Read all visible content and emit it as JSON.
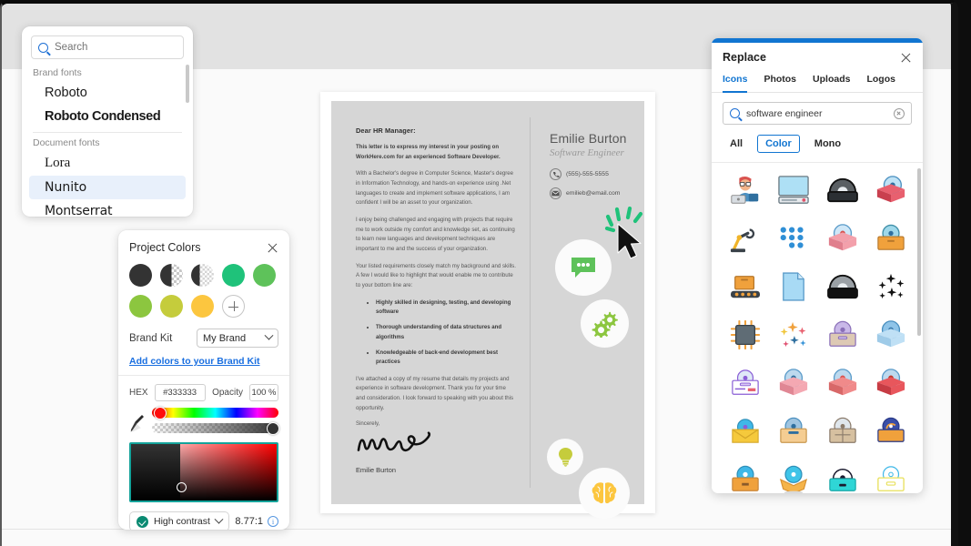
{
  "font_picker": {
    "search": {
      "placeholder": "Search",
      "value": "",
      "icon": "search-icon"
    },
    "groups": [
      {
        "label": "Brand fonts",
        "fonts": [
          {
            "name": "Roboto",
            "selected": false
          },
          {
            "name": "Roboto Condensed",
            "selected": false
          }
        ]
      },
      {
        "label": "Document fonts",
        "fonts": [
          {
            "name": "Lora",
            "selected": false
          },
          {
            "name": "Nunito",
            "selected": true
          },
          {
            "name": "Montserrat",
            "selected": false
          }
        ]
      }
    ]
  },
  "project_colors": {
    "title": "Project Colors",
    "close_icon": "close-icon",
    "swatches": [
      {
        "name": "dark-solid",
        "hex": "#333333",
        "style": "solid"
      },
      {
        "name": "dark-half",
        "hex": "#333333",
        "style": "half-checker"
      },
      {
        "name": "dark-quarter",
        "hex": "#333333",
        "style": "quarter-checker"
      },
      {
        "name": "green-teal",
        "hex": "#1fc27a",
        "style": "solid"
      },
      {
        "name": "green-medium",
        "hex": "#5ec25a",
        "style": "solid"
      },
      {
        "name": "green-light",
        "hex": "#8cc63f",
        "style": "solid"
      },
      {
        "name": "yellow-green",
        "hex": "#c5cc3c",
        "style": "solid"
      },
      {
        "name": "amber",
        "hex": "#fcc63f",
        "style": "solid"
      },
      {
        "name": "add",
        "hex": "",
        "style": "add"
      }
    ],
    "brand_kit_label": "Brand Kit",
    "brand_kit_value": "My Brand",
    "add_colors_link": "Add colors to your Brand Kit",
    "hex_label": "HEX",
    "hex_value": "#333333",
    "opacity_label": "Opacity",
    "opacity_value": "100 %",
    "eyedropper_icon": "eyedropper-icon",
    "contrast_label": "High contrast",
    "contrast_ratio": "8.77:1",
    "info_icon": "info-icon",
    "selected_swatch_border": "#14a39a"
  },
  "document": {
    "greeting": "Dear HR Manager:",
    "paragraphs": [
      {
        "bold": true,
        "text": "This letter is to express my interest in your posting on WorkHere.com for an experienced Software Developer."
      },
      {
        "bold": false,
        "text": "With a Bachelor's degree in Computer Science, Master's degree in Information Technology, and hands-on experience using .Net languages to create and implement software applications, I am confident I will be an asset to your organization."
      },
      {
        "bold": false,
        "text": "I enjoy being challenged and engaging with projects that require me to work outside my comfort and knowledge set, as continuing to learn new languages and development techniques are important to me and the success of your organization."
      },
      {
        "bold": false,
        "text": "Your listed requirements closely match my background and skills. A few I would like to highlight that would enable me to contribute to your bottom line are:"
      }
    ],
    "bullets": [
      "Highly skilled in designing, testing, and developing software",
      "Thorough understanding of data structures and algorithms",
      "Knowledgeable of back-end development best practices"
    ],
    "closing_paragraph": "I've attached a copy of my resume that details my projects and experience in software development. Thank you for your time and consideration. I look forward to speaking with you about this opportunity.",
    "signoff": "Sincerely,",
    "signature_name": "Emilie Burton",
    "contact": {
      "name": "Emilie Burton",
      "role": "Software Engineer",
      "phone": "(555)-555-5555",
      "phone_icon": "phone-icon",
      "email": "emilieb@email.com",
      "email_icon": "envelope-icon"
    },
    "decorative_icons": [
      {
        "name": "chat-bubble-icon",
        "color": "#5ec25a"
      },
      {
        "name": "gears-icon",
        "color": "#8cc63f"
      },
      {
        "name": "lightbulb-icon",
        "color": "#c5cc3c"
      },
      {
        "name": "brain-icon",
        "color": "#fcc63f"
      }
    ],
    "cursor_icon": "mouse-cursor-arrow",
    "selection_burst_color": "#1fc27a"
  },
  "replace_panel": {
    "title": "Replace",
    "close_icon": "close-icon",
    "tabs": [
      {
        "label": "Icons",
        "active": true
      },
      {
        "label": "Photos",
        "active": false
      },
      {
        "label": "Uploads",
        "active": false
      },
      {
        "label": "Logos",
        "active": false
      }
    ],
    "search": {
      "value": "software engineer",
      "icon": "search-icon",
      "clear_icon": "clear-icon"
    },
    "filters": [
      {
        "label": "All",
        "active": false
      },
      {
        "label": "Color",
        "active": true
      },
      {
        "label": "Mono",
        "active": false
      }
    ],
    "accent_color": "#1175d1",
    "results": [
      "developer-avatar-icon",
      "computer-monitor-icon",
      "dark-dome-icon",
      "red-box-disc-icon",
      "robot-arm-icon",
      "blue-dots-icon",
      "pink-box-disc-icon",
      "orange-box-disc-icon",
      "conveyor-box-icon",
      "blue-document-icon",
      "gray-dome-icon",
      "black-sparkle-icon",
      "microchip-icon",
      "color-sparkle-icon",
      "tan-box-disc-icon",
      "lightblue-box-disc-icon",
      "purple-card-icon",
      "pink-box-disc-icon",
      "coral-box-disc-icon",
      "red-box-disc-icon",
      "yellow-envelope-icon",
      "tan-box-disc-icon",
      "brown-box-disc-icon",
      "navy-box-disc-icon",
      "orange-box-disc-icon",
      "orange-open-box-icon",
      "cyan-box-disc-icon",
      "outline-box-disc-icon"
    ]
  }
}
